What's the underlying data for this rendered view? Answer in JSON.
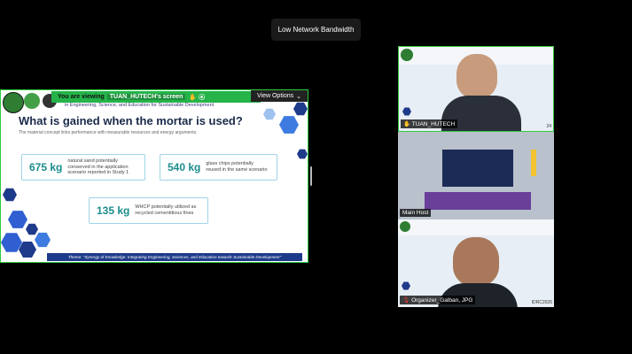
{
  "toast": {
    "text": "Low Network Bandwidth"
  },
  "share": {
    "viewing_prefix": "You are viewing",
    "presenter": "TUAN_HUTECH's screen",
    "view_options": "View Options",
    "header_line": "in Engineering, Science, and Education for Sustainable Development",
    "slide_title": "What is gained when the mortar is used?",
    "slide_subtitle": "The material concept links performance with measurable resources and energy arguments.",
    "cards": [
      {
        "value": "675 kg",
        "desc": "natural sand potentially conserved in the application scenario reported in Study 1"
      },
      {
        "value": "540 kg",
        "desc": "glass chips potentially reused in the same scenario"
      },
      {
        "value": "135 kg",
        "desc": "WHCP potentially utilized as recycled cementitious fines"
      }
    ],
    "theme": "Theme: \"Synergy of Knowledge: Integrating Engineering, Sciences, and Education towards Sustainable Development\""
  },
  "tiles": [
    {
      "label": "TUAN_HUTECH",
      "corner": "24"
    },
    {
      "label": "Main Host"
    },
    {
      "label": "Organizer_Galban, JPG",
      "corner": "IDRC2026"
    }
  ],
  "colors": {
    "accent": "#2ecc40",
    "brand": "#1e3a8a"
  }
}
